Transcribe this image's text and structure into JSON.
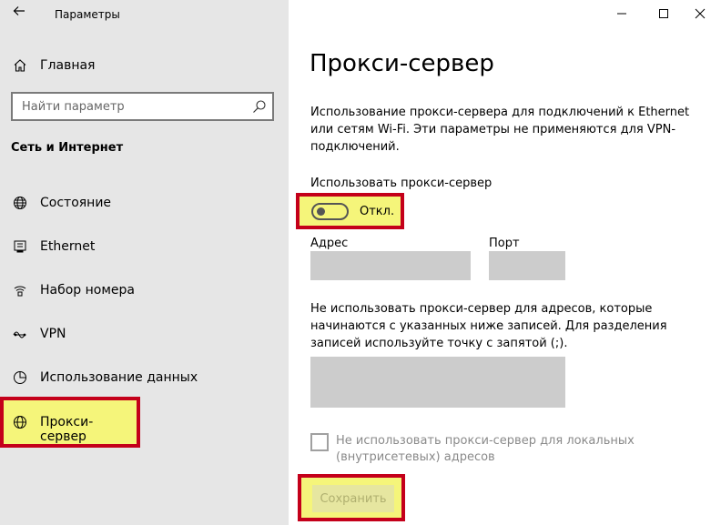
{
  "window": {
    "title": "Параметры"
  },
  "sidebar": {
    "home_label": "Главная",
    "search_placeholder": "Найти параметр",
    "section_title": "Сеть и Интернет",
    "items": [
      {
        "label": "Состояние",
        "icon": "globe-icon"
      },
      {
        "label": "Ethernet",
        "icon": "ethernet-icon"
      },
      {
        "label": "Набор номера",
        "icon": "dialup-icon"
      },
      {
        "label": "VPN",
        "icon": "vpn-icon"
      },
      {
        "label": "Использование данных",
        "icon": "data-usage-icon"
      },
      {
        "label": "Прокси-сервер",
        "icon": "globe-icon",
        "active": true
      }
    ]
  },
  "main": {
    "page_title": "Прокси-сервер",
    "description": "Использование прокси-сервера для подключений к Ethernet или сетям Wi-Fi. Эти параметры не применяются для VPN-подключений.",
    "use_proxy_label": "Использовать прокси-сервер",
    "toggle_state": "Откл.",
    "address_label": "Адрес",
    "port_label": "Порт",
    "exceptions_description": "Не использовать прокси-сервер для адресов, которые начинаются с указанных ниже записей. Для разделения записей используйте точку с запятой (;).",
    "local_checkbox_label": "Не использовать прокси-сервер для локальных (внутрисетевых) адресов",
    "save_label": "Сохранить"
  },
  "colors": {
    "highlight_fill": "#f5f57a",
    "highlight_border": "#c4001a",
    "sidebar_bg": "#e6e6e6",
    "disabled_input": "#cccccc"
  }
}
